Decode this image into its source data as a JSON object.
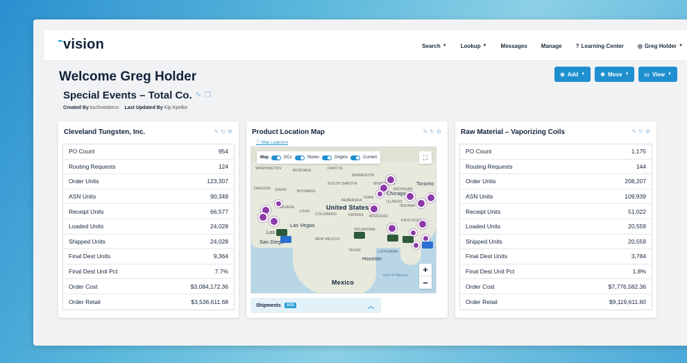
{
  "app": {
    "logo": "vision",
    "nav": [
      {
        "label": "Search",
        "caret": true
      },
      {
        "label": "Lookup",
        "caret": true
      },
      {
        "label": "Messages",
        "caret": false
      },
      {
        "label": "Manage",
        "caret": false
      },
      {
        "label": "Learning Center",
        "caret": false
      },
      {
        "label": "Greg Holder",
        "caret": true
      }
    ]
  },
  "header": {
    "welcome": "Welcome Greg Holder",
    "dashboard_title": "Special Events – Total Co.",
    "created_by_label": "Created By",
    "created_by": "bschneidercn",
    "updated_by_label": "Last Updated By",
    "updated_by": "Kip Kpelke"
  },
  "actions": {
    "add": "Add",
    "move": "Move",
    "view": "View"
  },
  "cards": {
    "left": {
      "title": "Cleveland Tungsten, Inc.",
      "rows": [
        {
          "label": "PO Count",
          "value": "954"
        },
        {
          "label": "Routing Requests",
          "value": "124"
        },
        {
          "label": "Order Units",
          "value": "123,307"
        },
        {
          "label": "ASN Units",
          "value": "90,349"
        },
        {
          "label": "Receipt Units",
          "value": "66,577"
        },
        {
          "label": "Loaded Units",
          "value": "24,028"
        },
        {
          "label": "Shipped Units",
          "value": "24,028"
        },
        {
          "label": "Final Dest Units",
          "value": "9,364"
        },
        {
          "label": "Final Dest Unit Pct",
          "value": "7.7%"
        },
        {
          "label": "Order Cost",
          "value": "$3,084,172.36"
        },
        {
          "label": "Order Retail",
          "value": "$3,536,611.68"
        }
      ]
    },
    "map": {
      "title": "Product Location Map",
      "legend_link": "Map Legend",
      "toolbar": {
        "map": "Map",
        "dcs": "DCs",
        "stores": "Stores",
        "origins": "Origins",
        "current": "Current"
      },
      "labels": {
        "us": "United States",
        "mexico": "Mexico",
        "las_vegas": "Las Vegas",
        "san_diego": "San Diego",
        "houston": "Houston",
        "toronto": "Toronto",
        "gulf": "Gulf of Mexico",
        "montana": "MONTANA",
        "nevada": "NEVADA",
        "utah": "UTAH",
        "texas": "TEXAS",
        "oklahoma": "OKLAHOMA",
        "kansas": "KANSAS",
        "missouri": "MISSOURI",
        "nebraska": "NEBRASKA",
        "iowa": "IOWA",
        "colorado": "COLORADO",
        "wyoming": "WYOMING",
        "oregon": "OREGON",
        "idaho": "IDAHO",
        "new_mexico": "NEW MEXICO",
        "south_dakota": "SOUTH DAKOTA",
        "minnesota": "MINNESOTA",
        "illinois": "ILLINOIS",
        "indiana": "INDIANA",
        "kentucky": "KENTUCKY",
        "louisiana": "LOUISIANA",
        "chicago": "Chicago",
        "wisconsin": "WISCONSIN",
        "michigan": "MICHIGAN",
        "washington": "WASHINGTON",
        "dakota": "DAKOTA",
        "los": "Los"
      },
      "shipments_label": "Shipments",
      "shipments_badge": "1015"
    },
    "right": {
      "title": "Raw Material – Vaporizing Coils",
      "rows": [
        {
          "label": "PO Count",
          "value": "1,175"
        },
        {
          "label": "Routing Requests",
          "value": "144"
        },
        {
          "label": "Order Units",
          "value": "208,207"
        },
        {
          "label": "ASN Units",
          "value": "109,939"
        },
        {
          "label": "Receipt Units",
          "value": "51,022"
        },
        {
          "label": "Loaded Units",
          "value": "20,559"
        },
        {
          "label": "Shipped Units",
          "value": "20,559"
        },
        {
          "label": "Final Dest Units",
          "value": "3,784"
        },
        {
          "label": "Final Dest Unit Pct",
          "value": "1.8%"
        },
        {
          "label": "Order Cost",
          "value": "$7,776,582.36"
        },
        {
          "label": "Order Retail",
          "value": "$9,119,611.60"
        }
      ]
    }
  }
}
